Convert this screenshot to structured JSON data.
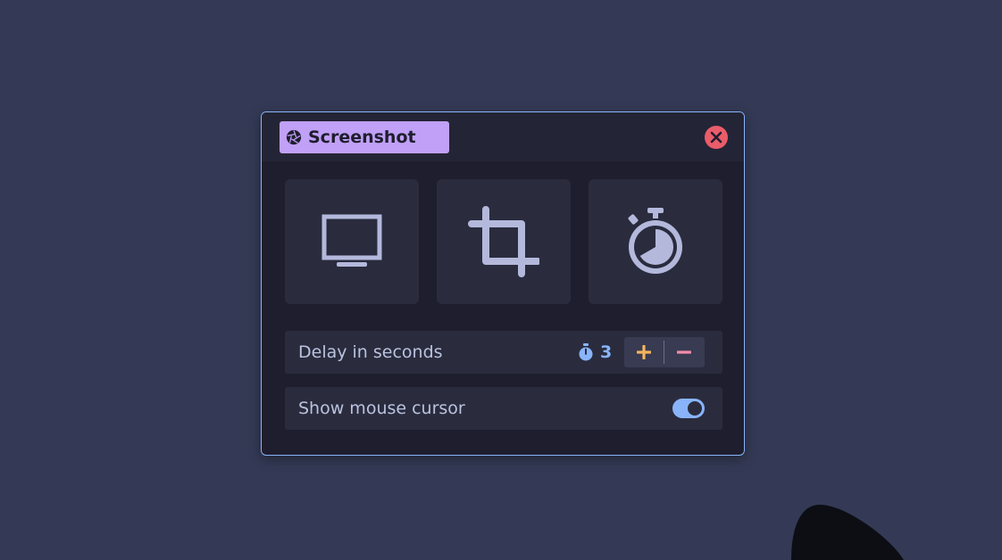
{
  "window": {
    "title": "Screenshot",
    "title_icon": "aperture-icon",
    "close_icon": "close-icon"
  },
  "modes": [
    {
      "name": "fullscreen",
      "icon": "monitor-icon"
    },
    {
      "name": "region",
      "icon": "crop-icon"
    },
    {
      "name": "timer",
      "icon": "stopwatch-icon"
    }
  ],
  "delay": {
    "label": "Delay in seconds",
    "value": "3",
    "icon": "stopwatch-small-icon",
    "increase_icon": "plus-icon",
    "decrease_icon": "minus-icon"
  },
  "cursor_option": {
    "label": "Show mouse cursor",
    "enabled": true
  },
  "colors": {
    "desktop": "#343a55",
    "dialog_bg": "#1e1e2e",
    "border": "#89b4fa",
    "title_pill": "#c1a0f7",
    "close": "#eb5c6a",
    "accent": "#89b4fa",
    "plus": "#f5b45c",
    "minus": "#f38ba8",
    "icon": "#b4b9dc"
  }
}
